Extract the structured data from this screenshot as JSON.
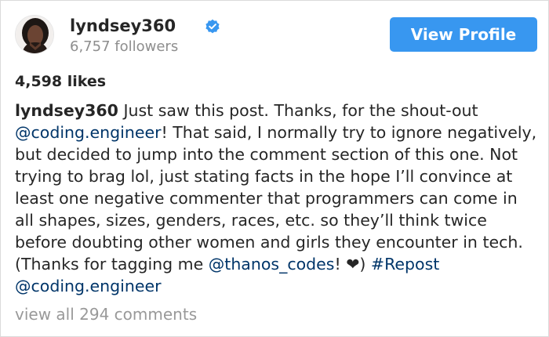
{
  "post": {
    "username": "lyndsey360",
    "followers": "6,757 followers",
    "view_profile_label": "View Profile",
    "likes": "4,598 likes",
    "caption": {
      "author": "lyndsey360",
      "text_1": " Just saw this post. Thanks, for the shout-out ",
      "mention_1": "@coding.engineer",
      "text_2": "! That said, I normally try to ignore negatively, but decided to jump into the comment section of this one. Not trying to brag lol, just stating facts in the hope I’ll convince at least one negative commenter that programmers can come in all shapes, sizes, genders, races, etc. so they’ll think twice before doubting other women and girls they encounter in tech. (Thanks for tagging me ",
      "mention_2": "@thanos_codes",
      "text_3": "! ❤) ",
      "hashtag": "#Repost",
      "text_4": " ",
      "mention_3": "@coding.engineer"
    },
    "view_all_comments": "view all 294 comments"
  },
  "colors": {
    "button_blue": "#3897f0",
    "verified_blue": "#3897f0",
    "link_blue": "#003569",
    "muted_gray": "#8e8e8e"
  },
  "icons": {
    "verified": "verified-badge-icon",
    "avatar": "profile-avatar"
  }
}
